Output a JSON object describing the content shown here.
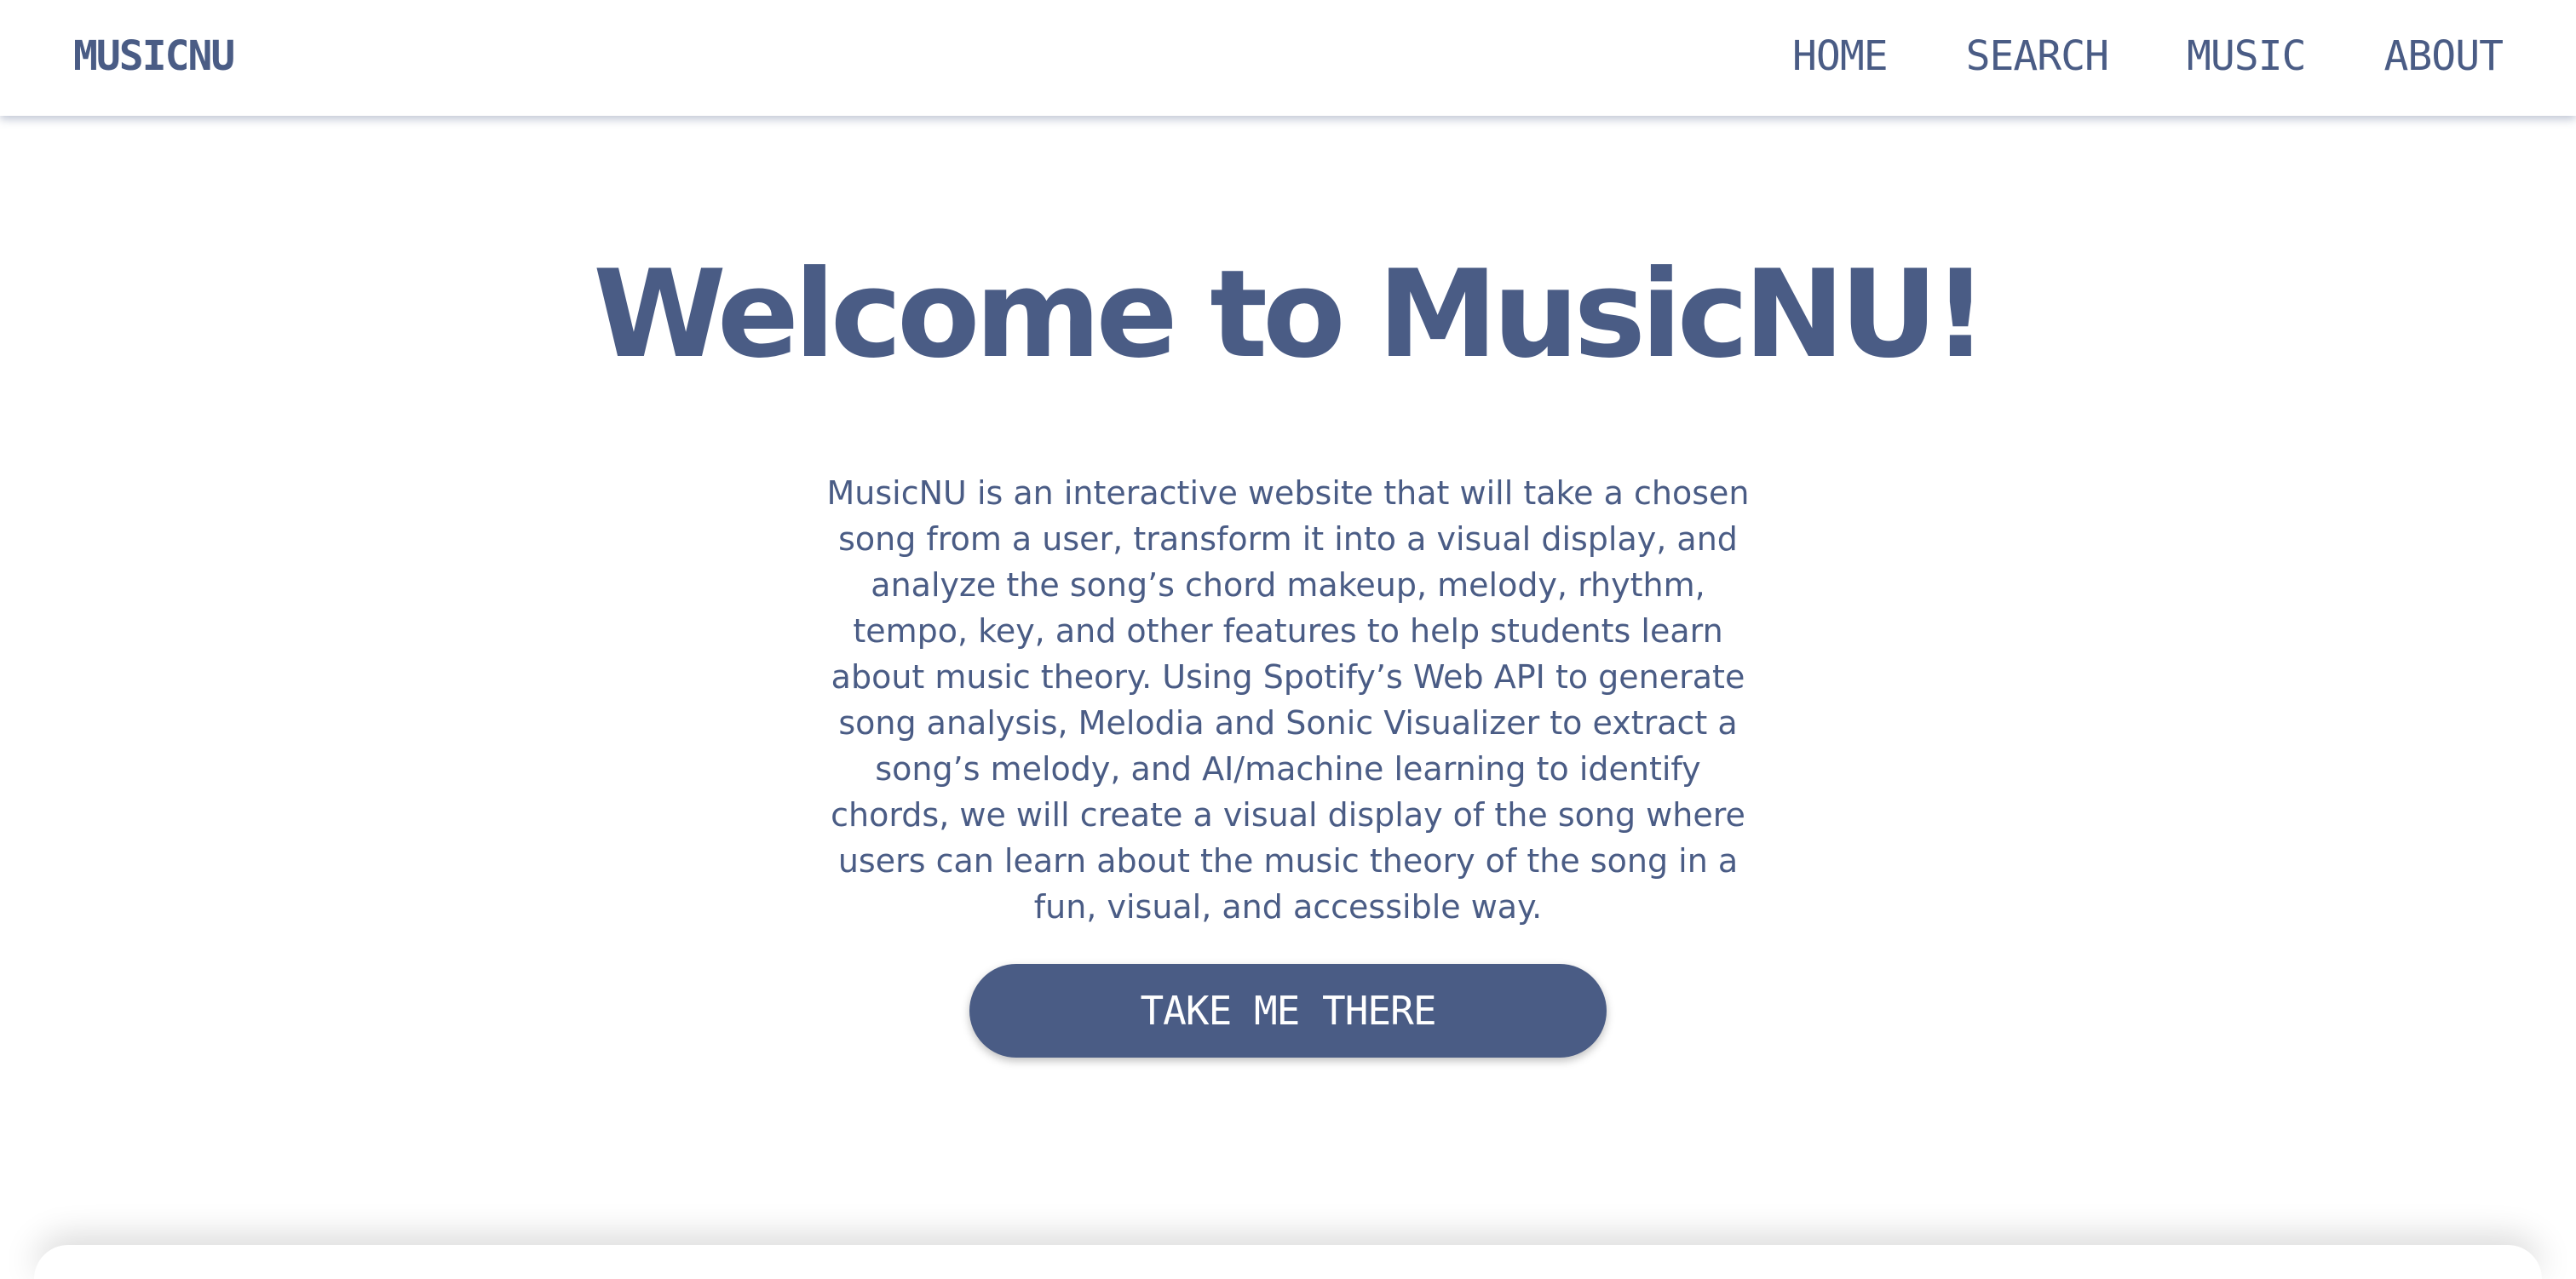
{
  "navbar": {
    "brand": "MUSICNU",
    "links": [
      {
        "label": "HOME"
      },
      {
        "label": "SEARCH"
      },
      {
        "label": "MUSIC"
      },
      {
        "label": "ABOUT"
      }
    ]
  },
  "hero": {
    "title": "Welcome to MusicNU!",
    "description": "MusicNU is an interactive website that will take a chosen song from a user, transform it into a visual display, and analyze the song’s chord makeup, melody, rhythm, tempo, key, and other features to help students learn about music theory. Using Spotify’s Web API to generate song analysis, Melodia and Sonic Visualizer to extract a song’s melody, and AI/machine learning to identify chords, we will create a visual display of the song where users can learn about the music theory of the song in a fun, visual, and accessible way.",
    "cta_label": "TAKE ME THERE"
  },
  "colors": {
    "primary": "#4a5c85",
    "background": "#ffffff",
    "button_text": "#ffffff"
  }
}
